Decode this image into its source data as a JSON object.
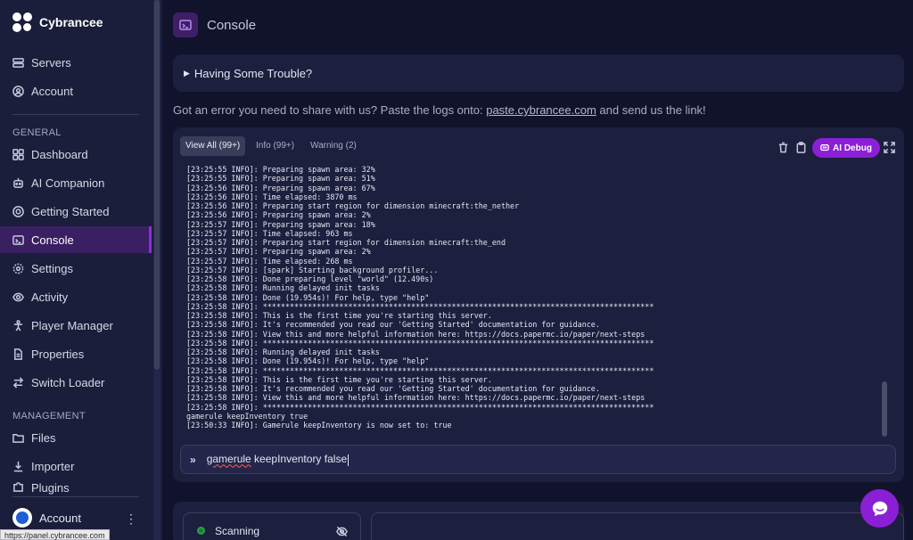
{
  "brand": {
    "name": "Cybrancee"
  },
  "sidebar": {
    "top_items": [
      {
        "label": "Servers",
        "icon": "server-icon"
      },
      {
        "label": "Account",
        "icon": "user-circle-icon"
      }
    ],
    "general_label": "GENERAL",
    "general_items": [
      {
        "label": "Dashboard",
        "icon": "grid-icon"
      },
      {
        "label": "AI Companion",
        "icon": "robot-icon"
      },
      {
        "label": "Getting Started",
        "icon": "lifebuoy-icon"
      },
      {
        "label": "Console",
        "icon": "terminal-icon",
        "active": true
      },
      {
        "label": "Settings",
        "icon": "gear-icon"
      },
      {
        "label": "Activity",
        "icon": "eye-icon"
      },
      {
        "label": "Player Manager",
        "icon": "person-icon"
      },
      {
        "label": "Properties",
        "icon": "file-icon"
      },
      {
        "label": "Switch Loader",
        "icon": "swap-icon"
      }
    ],
    "management_label": "MANAGEMENT",
    "management_items": [
      {
        "label": "Files",
        "icon": "folder-icon"
      },
      {
        "label": "Importer",
        "icon": "download-icon"
      },
      {
        "label": "Plugins",
        "icon": "puzzle-icon"
      }
    ],
    "account_bottom": {
      "label": "Account"
    },
    "url_tooltip": "https://panel.cybrancee.com"
  },
  "header": {
    "title": "Console"
  },
  "trouble": {
    "label": "Having Some Trouble?"
  },
  "share": {
    "prefix": "Got an error you need to share with us? Paste the logs onto: ",
    "link": "paste.cybrancee.com",
    "suffix": " and send us the link!"
  },
  "console": {
    "tabs": [
      {
        "label": "View All (99+)",
        "active": true
      },
      {
        "label": "Info (99+)"
      },
      {
        "label": "Warning (2)"
      }
    ],
    "ai_debug_label": "AI Debug",
    "log_lines": [
      "[23:25:55 INFO]: Preparing spawn area: 32%",
      "[23:25:55 INFO]: Preparing spawn area: 51%",
      "[23:25:56 INFO]: Preparing spawn area: 67%",
      "[23:25:56 INFO]: Time elapsed: 3870 ms",
      "[23:25:56 INFO]: Preparing start region for dimension minecraft:the_nether",
      "[23:25:56 INFO]: Preparing spawn area: 2%",
      "[23:25:57 INFO]: Preparing spawn area: 18%",
      "[23:25:57 INFO]: Time elapsed: 963 ms",
      "[23:25:57 INFO]: Preparing start region for dimension minecraft:the_end",
      "[23:25:57 INFO]: Preparing spawn area: 2%",
      "[23:25:57 INFO]: Time elapsed: 268 ms",
      "[23:25:57 INFO]: [spark] Starting background profiler...",
      "[23:25:58 INFO]: Done preparing level \"world\" (12.490s)",
      "[23:25:58 INFO]: Running delayed init tasks",
      "[23:25:58 INFO]: Done (19.954s)! For help, type \"help\"",
      "[23:25:58 INFO]: ***************************************************************************************",
      "[23:25:58 INFO]: This is the first time you're starting this server.",
      "[23:25:58 INFO]: It's recommended you read our 'Getting Started' documentation for guidance.",
      "[23:25:58 INFO]: View this and more helpful information here: https://docs.papermc.io/paper/next-steps",
      "[23:25:58 INFO]: ***************************************************************************************",
      "[23:25:58 INFO]: Running delayed init tasks",
      "[23:25:58 INFO]: Done (19.954s)! For help, type \"help\"",
      "[23:25:58 INFO]: ***************************************************************************************",
      "[23:25:58 INFO]: This is the first time you're starting this server.",
      "[23:25:58 INFO]: It's recommended you read our 'Getting Started' documentation for guidance.",
      "[23:25:58 INFO]: View this and more helpful information here: https://docs.papermc.io/paper/next-steps",
      "[23:25:58 INFO]: ***************************************************************************************",
      "gamerule keepInventory true",
      "[23:50:33 INFO]: Gamerule keepInventory is now set to: true"
    ],
    "input_value": "gamerule keepInventory false"
  },
  "status": {
    "scanning_label": "Scanning"
  },
  "colors": {
    "accent": "#8b1fd6",
    "background": "#11132c",
    "card": "#1c1f3d"
  }
}
